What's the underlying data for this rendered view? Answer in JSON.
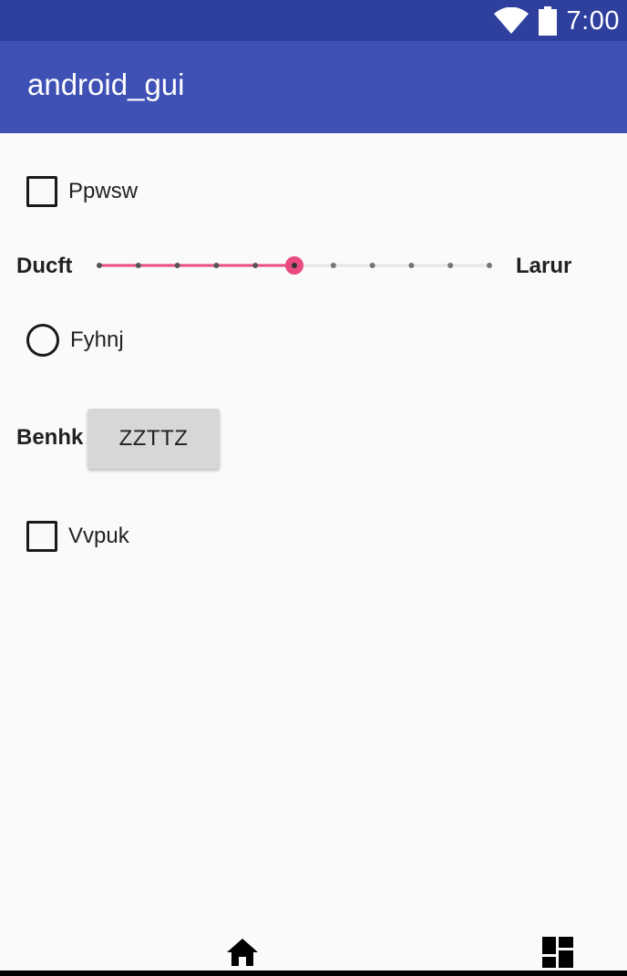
{
  "status_bar": {
    "time": "7:00",
    "icons": [
      "wifi-icon",
      "battery-icon"
    ],
    "background": "#2e3f9e"
  },
  "app_bar": {
    "title": "android_gui",
    "background": "#3f51b5"
  },
  "content": {
    "checkbox_1": {
      "label": "Ppwsw",
      "checked": false
    },
    "seekbar": {
      "left_label": "Ducft",
      "right_label": "Larur",
      "min": 0,
      "max": 10,
      "value": 5,
      "accent": "#e94b7f"
    },
    "radio_1": {
      "label": "Fyhnj",
      "checked": false
    },
    "text_label": "Benhk",
    "button_label": "ZZTTZ",
    "checkbox_2": {
      "label": "Vvpuk",
      "checked": false
    }
  },
  "nav": {
    "icons": [
      "home-icon",
      "dashboard-icon"
    ]
  }
}
